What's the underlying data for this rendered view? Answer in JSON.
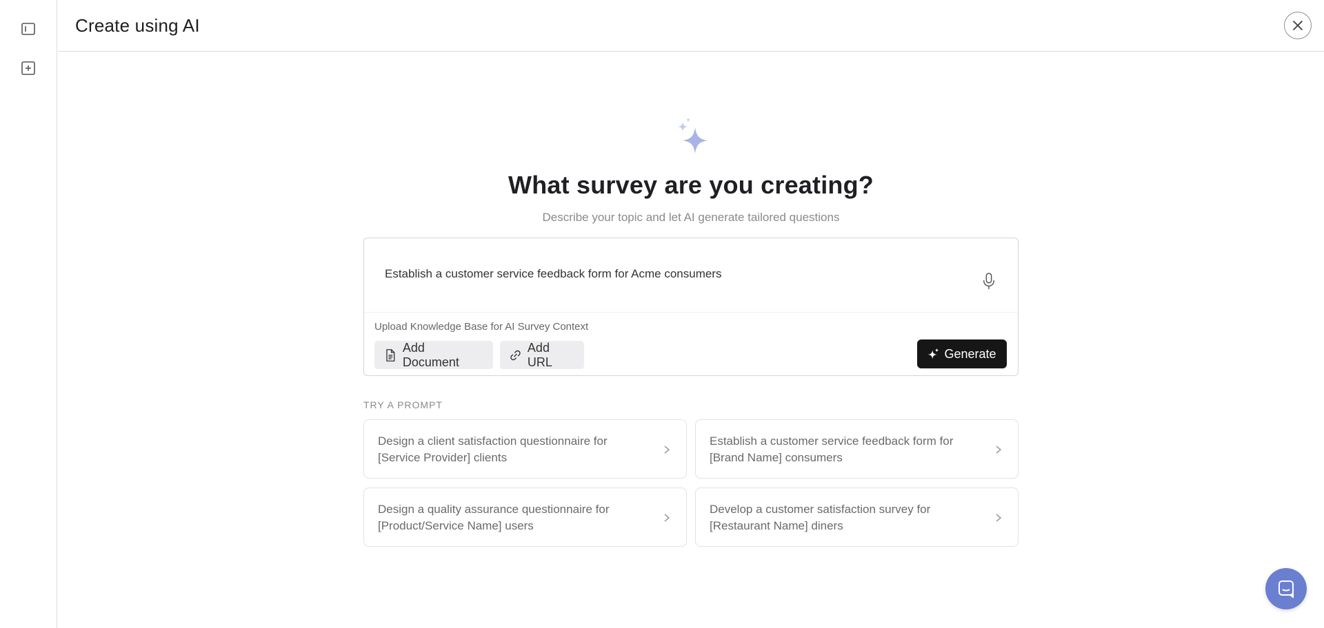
{
  "header": {
    "title": "Create using AI"
  },
  "sidebar": {
    "items": [
      {
        "icon": "sidebar-toggle-icon"
      },
      {
        "icon": "add-square-icon"
      }
    ]
  },
  "main": {
    "heading": "What survey are you creating?",
    "subheading": "Describe your topic and let AI generate tailored questions",
    "prompt": {
      "value": "Establish a customer service feedback form for Acme consumers",
      "mic_icon": "microphone-icon"
    },
    "knowledge_base": {
      "label": "Upload Knowledge Base for AI Survey Context",
      "add_document_label": "Add Document",
      "add_url_label": "Add URL"
    },
    "generate_label": "Generate",
    "try_prompt_label": "TRY A PROMPT",
    "suggestions": [
      {
        "text": "Design a client satisfaction questionnaire for [Service Provider] clients"
      },
      {
        "text": "Establish a customer service feedback form for [Brand Name] consumers"
      },
      {
        "text": "Design a quality assurance questionnaire for [Product/Service Name] users"
      },
      {
        "text": "Develop a customer satisfaction survey for [Restaurant Name] diners"
      }
    ]
  },
  "colors": {
    "accent_dark": "#161616",
    "sparkle": "#a9b3e6",
    "chat_bubble": "#6a7fd0",
    "muted_text": "#8a8a8a"
  }
}
